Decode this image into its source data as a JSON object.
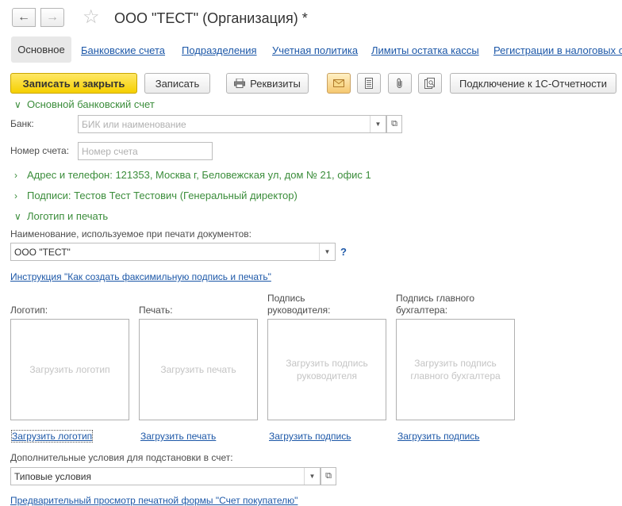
{
  "header": {
    "back_icon": "arrow-left-icon",
    "forward_icon": "arrow-right-icon",
    "star_icon": "star-icon",
    "title": "ООО \"ТЕСТ\" (Организация) *"
  },
  "tabs": [
    {
      "label": "Основное"
    },
    {
      "label": "Банковские счета"
    },
    {
      "label": "Подразделения"
    },
    {
      "label": "Учетная политика"
    },
    {
      "label": "Лимиты остатка кассы"
    },
    {
      "label": "Регистрации в налоговых о"
    }
  ],
  "toolbar": {
    "save_close": "Записать и закрыть",
    "save": "Записать",
    "requisites": "Реквизиты",
    "connect": "Подключение к 1С-Отчетности",
    "icons": [
      "envelope-icon",
      "document-list-icon",
      "paperclip-icon",
      "report-icon"
    ]
  },
  "form": {
    "bank_account_group": "Основной банковский счет",
    "bank_label": "Банк:",
    "bank_placeholder": "БИК или наименование",
    "account_label": "Номер счета:",
    "account_placeholder": "Номер счета",
    "address_group": "Адрес и телефон: 121353, Москва г, Беловежская ул, дом № 21, офис 1",
    "signatures_group": "Подписи: Тестов Тест Тестович (Генеральный директор)",
    "logo_group": "Логотип и печать",
    "print_name_label": "Наименование, используемое при печати документов:",
    "print_name_value": "ООО \"ТЕСТ\"",
    "help": "?",
    "instruction_link": "Инструкция \"Как создать факсимильную подпись и печать\"",
    "images": [
      {
        "label": "Логотип:",
        "placeholder": "Загрузить логотип",
        "link": "Загрузить логотип"
      },
      {
        "label": "Печать:",
        "placeholder": "Загрузить печать",
        "link": "Загрузить печать"
      },
      {
        "label": "Подпись руководителя:",
        "placeholder": "Загрузить подпись руководителя",
        "link": "Загрузить подпись"
      },
      {
        "label": "Подпись главного бухгалтера:",
        "placeholder": "Загрузить подпись главного бухгалтера",
        "link": "Загрузить подпись"
      }
    ],
    "conditions_label": "Дополнительные условия для подстановки в счет:",
    "conditions_value": "Типовые условия",
    "preview_link": "Предварительный просмотр печатной формы \"Счет покупателю\""
  }
}
